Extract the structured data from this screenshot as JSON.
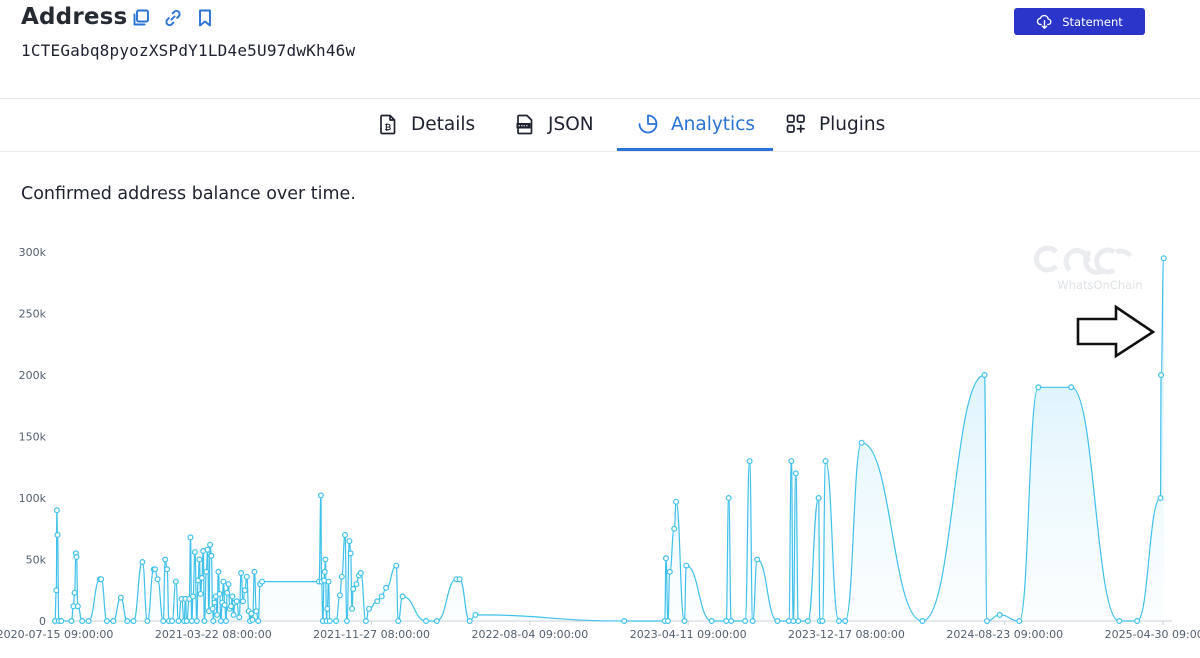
{
  "header": {
    "title": "Address",
    "address": "1CTEGabq8pyozXSPdY1LD4e5U97dwKh46w",
    "icons": [
      "copy-icon",
      "link-icon",
      "bookmark-icon"
    ],
    "statement_label": "Statement",
    "statement_icon": "cloud-download-icon"
  },
  "tabs": [
    {
      "label": "Details",
      "icon": "bitcoin-doc-icon",
      "active": false
    },
    {
      "label": "JSON",
      "icon": "json-file-icon",
      "active": false
    },
    {
      "label": "Analytics",
      "icon": "pie-chart-icon",
      "active": true
    },
    {
      "label": "Plugins",
      "icon": "plugins-grid-icon",
      "active": false
    }
  ],
  "chart_caption": "Confirmed address balance over time.",
  "watermark": "WhatsOnChain",
  "colors": {
    "accent": "#2a72d6",
    "button": "#2b35c9",
    "series": "#3fc1eb",
    "area": "#cfeefb"
  },
  "chart_data": {
    "type": "area",
    "title": "",
    "xlabel": "",
    "ylabel": "",
    "ylim": [
      0,
      300000
    ],
    "y_ticks": [
      "0",
      "50k",
      "100k",
      "150k",
      "200k",
      "250k",
      "300k"
    ],
    "x_ticks": [
      "2020-07-15 09:00:00",
      "2021-03-22 08:00:00",
      "2021-11-27 08:00:00",
      "2022-08-04 09:00:00",
      "2023-04-11 09:00:00",
      "2023-12-17 08:00:00",
      "2024-08-23 09:00:00",
      "2025-04-30 09:00:00"
    ],
    "x_range": [
      "2020-07-15",
      "2025-05-11"
    ],
    "annotation": "arrow pointing to latest balance",
    "series": [
      {
        "points": [
          [
            "2020-07-15",
            0
          ],
          [
            "2020-07-17",
            25000
          ],
          [
            "2020-07-18",
            90000
          ],
          [
            "2020-07-19",
            70000
          ],
          [
            "2020-07-21",
            0
          ],
          [
            "2020-07-25",
            0
          ],
          [
            "2020-08-10",
            0
          ],
          [
            "2020-08-13",
            12000
          ],
          [
            "2020-08-15",
            23000
          ],
          [
            "2020-08-17",
            55000
          ],
          [
            "2020-08-18",
            52000
          ],
          [
            "2020-08-20",
            12000
          ],
          [
            "2020-08-27",
            0
          ],
          [
            "2020-09-06",
            0
          ],
          [
            "2020-09-24",
            34000
          ],
          [
            "2020-09-26",
            34000
          ],
          [
            "2020-10-05",
            0
          ],
          [
            "2020-10-15",
            0
          ],
          [
            "2020-10-27",
            19000
          ],
          [
            "2020-11-06",
            0
          ],
          [
            "2020-11-16",
            0
          ],
          [
            "2020-11-30",
            48000
          ],
          [
            "2020-12-08",
            0
          ],
          [
            "2020-12-18",
            42000
          ],
          [
            "2020-12-20",
            42000
          ],
          [
            "2020-12-24",
            34000
          ],
          [
            "2021-01-02",
            0
          ],
          [
            "2021-01-05",
            50000
          ],
          [
            "2021-01-08",
            42000
          ],
          [
            "2021-01-11",
            0
          ],
          [
            "2021-01-16",
            0
          ],
          [
            "2021-01-22",
            32000
          ],
          [
            "2021-01-26",
            0
          ],
          [
            "2021-01-31",
            18000
          ],
          [
            "2021-02-04",
            0
          ],
          [
            "2021-02-06",
            18000
          ],
          [
            "2021-02-08",
            0
          ],
          [
            "2021-02-12",
            18000
          ],
          [
            "2021-02-14",
            68000
          ],
          [
            "2021-02-16",
            0
          ],
          [
            "2021-02-18",
            20000
          ],
          [
            "2021-02-21",
            56000
          ],
          [
            "2021-02-24",
            0
          ],
          [
            "2021-02-26",
            33000
          ],
          [
            "2021-02-28",
            50000
          ],
          [
            "2021-03-02",
            22000
          ],
          [
            "2021-03-04",
            35000
          ],
          [
            "2021-03-06",
            57000
          ],
          [
            "2021-03-08",
            0
          ],
          [
            "2021-03-11",
            40000
          ],
          [
            "2021-03-13",
            58000
          ],
          [
            "2021-03-15",
            8000
          ],
          [
            "2021-03-17",
            62000
          ],
          [
            "2021-03-19",
            53000
          ],
          [
            "2021-03-21",
            10000
          ],
          [
            "2021-03-22",
            0
          ],
          [
            "2021-03-24",
            15000
          ],
          [
            "2021-03-26",
            20000
          ],
          [
            "2021-03-28",
            5000
          ],
          [
            "2021-03-30",
            40000
          ],
          [
            "2021-04-01",
            22000
          ],
          [
            "2021-04-03",
            0
          ],
          [
            "2021-04-05",
            15000
          ],
          [
            "2021-04-07",
            32000
          ],
          [
            "2021-04-09",
            13000
          ],
          [
            "2021-04-11",
            0
          ],
          [
            "2021-04-13",
            23000
          ],
          [
            "2021-04-15",
            30000
          ],
          [
            "2021-04-17",
            10000
          ],
          [
            "2021-04-19",
            12000
          ],
          [
            "2021-04-21",
            20000
          ],
          [
            "2021-04-23",
            5000
          ],
          [
            "2021-04-25",
            15000
          ],
          [
            "2021-04-28",
            16000
          ],
          [
            "2021-05-02",
            3000
          ],
          [
            "2021-05-05",
            39000
          ],
          [
            "2021-05-08",
            16000
          ],
          [
            "2021-05-11",
            25000
          ],
          [
            "2021-05-14",
            36000
          ],
          [
            "2021-05-17",
            8000
          ],
          [
            "2021-05-19",
            0
          ],
          [
            "2021-05-21",
            6000
          ],
          [
            "2021-05-23",
            1000
          ],
          [
            "2021-05-26",
            40000
          ],
          [
            "2021-05-29",
            8000
          ],
          [
            "2021-06-01",
            0
          ],
          [
            "2021-06-04",
            30000
          ],
          [
            "2021-06-07",
            32000
          ],
          [
            "2021-09-05",
            32000
          ],
          [
            "2021-09-08",
            102000
          ],
          [
            "2021-09-09",
            32000
          ],
          [
            "2021-09-11",
            0
          ],
          [
            "2021-09-13",
            33000
          ],
          [
            "2021-09-14",
            40000
          ],
          [
            "2021-09-15",
            50000
          ],
          [
            "2021-09-17",
            0
          ],
          [
            "2021-09-18",
            10000
          ],
          [
            "2021-09-20",
            32000
          ],
          [
            "2021-09-22",
            0
          ],
          [
            "2021-10-02",
            0
          ],
          [
            "2021-10-08",
            21000
          ],
          [
            "2021-10-11",
            36000
          ],
          [
            "2021-10-16",
            70000
          ],
          [
            "2021-10-19",
            0
          ],
          [
            "2021-10-23",
            65000
          ],
          [
            "2021-10-25",
            55000
          ],
          [
            "2021-10-27",
            10000
          ],
          [
            "2021-10-29",
            26000
          ],
          [
            "2021-11-03",
            30000
          ],
          [
            "2021-11-07",
            37000
          ],
          [
            "2021-11-10",
            39000
          ],
          [
            "2021-11-18",
            0
          ],
          [
            "2021-11-23",
            10000
          ],
          [
            "2021-12-06",
            16000
          ],
          [
            "2021-12-13",
            20000
          ],
          [
            "2021-12-20",
            27000
          ],
          [
            "2022-01-05",
            45000
          ],
          [
            "2022-01-08",
            0
          ],
          [
            "2022-01-15",
            20000
          ],
          [
            "2022-02-21",
            0
          ],
          [
            "2022-03-10",
            0
          ],
          [
            "2022-04-10",
            34000
          ],
          [
            "2022-04-15",
            34000
          ],
          [
            "2022-05-01",
            0
          ],
          [
            "2022-05-10",
            5000
          ],
          [
            "2022-12-31",
            0
          ],
          [
            "2023-03-05",
            0
          ],
          [
            "2023-03-07",
            51000
          ],
          [
            "2023-03-10",
            0
          ],
          [
            "2023-03-13",
            40000
          ],
          [
            "2023-03-20",
            75000
          ],
          [
            "2023-03-23",
            97000
          ],
          [
            "2023-04-05",
            0
          ],
          [
            "2023-04-08",
            45000
          ],
          [
            "2023-05-18",
            0
          ],
          [
            "2023-06-10",
            0
          ],
          [
            "2023-06-14",
            100000
          ],
          [
            "2023-06-18",
            0
          ],
          [
            "2023-07-10",
            0
          ],
          [
            "2023-07-17",
            130000
          ],
          [
            "2023-07-22",
            0
          ],
          [
            "2023-07-29",
            50000
          ],
          [
            "2023-08-30",
            0
          ],
          [
            "2023-09-17",
            0
          ],
          [
            "2023-09-21",
            130000
          ],
          [
            "2023-09-24",
            0
          ],
          [
            "2023-09-28",
            120000
          ],
          [
            "2023-10-02",
            0
          ],
          [
            "2023-10-17",
            0
          ],
          [
            "2023-11-03",
            100000
          ],
          [
            "2023-11-05",
            0
          ],
          [
            "2023-11-09",
            0
          ],
          [
            "2023-11-14",
            130000
          ],
          [
            "2023-12-05",
            0
          ],
          [
            "2023-12-15",
            0
          ],
          [
            "2024-01-10",
            145000
          ],
          [
            "2024-04-15",
            0
          ],
          [
            "2024-07-22",
            200000
          ],
          [
            "2024-07-26",
            0
          ],
          [
            "2024-08-15",
            5000
          ],
          [
            "2024-09-15",
            0
          ],
          [
            "2024-10-15",
            190000
          ],
          [
            "2024-12-06",
            190000
          ],
          [
            "2025-02-20",
            0
          ],
          [
            "2025-03-20",
            0
          ],
          [
            "2025-04-26",
            100000
          ],
          [
            "2025-04-27",
            200000
          ],
          [
            "2025-05-01",
            295000
          ]
        ]
      }
    ]
  }
}
